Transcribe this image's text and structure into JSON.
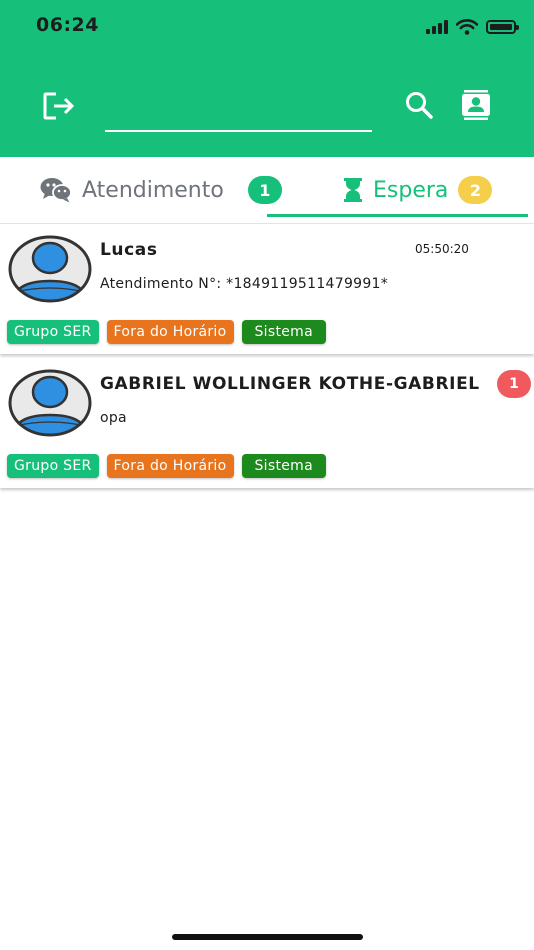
{
  "status_bar": {
    "time": "06:24"
  },
  "header": {
    "icons": [
      "logout-icon",
      "search-icon",
      "contact-card-icon"
    ],
    "search": {
      "value": "",
      "placeholder": ""
    },
    "color": "#16c07a"
  },
  "tabs": [
    {
      "label": "Atendimento",
      "icon": "chat-bubbles-icon",
      "count": "1",
      "badge_color": "#16c07a",
      "active": false
    },
    {
      "label": "Espera",
      "icon": "hourglass-icon",
      "count": "2",
      "badge_color": "#f5ce4c",
      "active": true
    }
  ],
  "conversations": [
    {
      "name": "Lucas",
      "time": "05:50:20",
      "last_message": "Atendimento N°: *1849119511479991*",
      "unread": "",
      "tags": [
        {
          "label": "Grupo SER",
          "color": "#16c07a"
        },
        {
          "label": "Fora do Horário",
          "color": "#e8741d"
        },
        {
          "label": "Sistema",
          "color": "#1c8a1c"
        }
      ]
    },
    {
      "name": "GABRIEL WOLLINGER KOTHE-GABRIEL",
      "time": "",
      "last_message": "opa",
      "unread": "1",
      "tags": [
        {
          "label": "Grupo SER",
          "color": "#16c07a"
        },
        {
          "label": "Fora do Horário",
          "color": "#e8741d"
        },
        {
          "label": "Sistema",
          "color": "#1c8a1c"
        }
      ]
    }
  ]
}
